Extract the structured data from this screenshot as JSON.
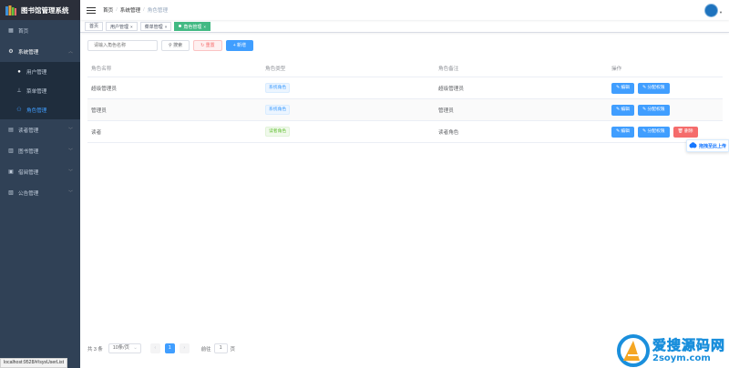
{
  "app": {
    "title": "图书馆管理系统"
  },
  "sidebar": {
    "items": [
      {
        "label": "首页",
        "icon": "dashboard-icon"
      },
      {
        "label": "系统管理",
        "icon": "gear-icon",
        "expanded": true,
        "children": [
          {
            "label": "用户管理",
            "icon": "user-icon"
          },
          {
            "label": "菜单管理",
            "icon": "tree-icon"
          },
          {
            "label": "角色管理",
            "icon": "peoples-icon",
            "active": true
          }
        ]
      },
      {
        "label": "读者管理",
        "icon": "reader-icon"
      },
      {
        "label": "图书管理",
        "icon": "book-icon"
      },
      {
        "label": "借阅管理",
        "icon": "borrow-icon"
      },
      {
        "label": "公告管理",
        "icon": "notice-icon"
      }
    ]
  },
  "header": {
    "breadcrumb": [
      "首页",
      "系统管理",
      "角色管理"
    ]
  },
  "tags": [
    {
      "label": "首页",
      "closable": false
    },
    {
      "label": "用户管理",
      "closable": true
    },
    {
      "label": "菜单管理",
      "closable": true
    },
    {
      "label": "角色管理",
      "closable": true,
      "active": true
    }
  ],
  "toolbar": {
    "search_placeholder": "请输入角色名称",
    "search_label": "搜索",
    "reset_label": "重置",
    "add_label": "新增"
  },
  "table": {
    "columns": [
      "角色名称",
      "角色类型",
      "角色备注",
      "操作"
    ],
    "rows": [
      {
        "name": "超级管理员",
        "type": "系统角色",
        "remark": "超级管理员",
        "actions": [
          "编辑",
          "分配权限"
        ]
      },
      {
        "name": "管理员",
        "type": "系统角色",
        "remark": "管理员",
        "actions": [
          "编辑",
          "分配权限"
        ]
      },
      {
        "name": "读者",
        "type": "读者角色",
        "remark": "读者角色",
        "actions": [
          "编辑",
          "分配权限",
          "删除"
        ]
      }
    ]
  },
  "pagination": {
    "total_text": "共 3 条",
    "page_size": "10条/页",
    "current_page": "1",
    "goto_label": "前往",
    "goto_value": "1",
    "page_unit": "页"
  },
  "float_widget": {
    "text": "拖拽至此上传"
  },
  "status_bar": {
    "url": "localhost:9528/#/sysUserList"
  },
  "watermark": {
    "line1": "爱搜源码网",
    "line2": "2soym.com"
  },
  "colors": {
    "sidebar_bg": "#304156",
    "primary": "#409eff",
    "success": "#42b983",
    "danger": "#f56c6c"
  }
}
